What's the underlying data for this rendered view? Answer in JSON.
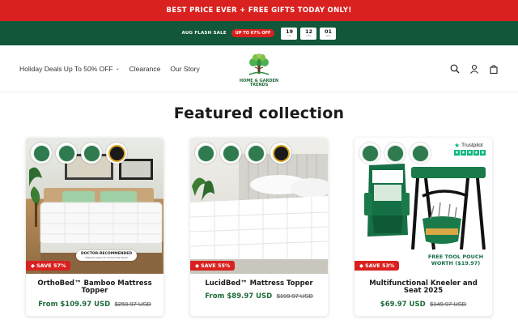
{
  "announcement": "BEST PRICE EVER + FREE GIFTS TODAY ONLY!",
  "flash_sale": {
    "label": "AUG FLASH SALE",
    "pill": "UP TO 67% OFF",
    "timer": [
      {
        "value": "19",
        "unit": "hrs"
      },
      {
        "value": "12",
        "unit": "mins"
      },
      {
        "value": "01",
        "unit": "secs"
      }
    ]
  },
  "nav": {
    "items": [
      {
        "label": "Holiday Deals Up To 50% OFF",
        "has_dropdown": true
      },
      {
        "label": "Clearance"
      },
      {
        "label": "Our Story"
      }
    ]
  },
  "logo": {
    "line1": "HOME & GARDEN",
    "line2": "TRENDS"
  },
  "header_icons": [
    "search-icon",
    "account-icon",
    "cart-icon"
  ],
  "section": {
    "title": "Featured collection"
  },
  "products": [
    {
      "title": "OrthoBed™ Bamboo Mattress Topper",
      "price": "From $109.97 USD",
      "compare_price": "$259.97 USD",
      "badge": "SAVE 57%",
      "overlay_title": "DOCTOR-RECOMMENDED",
      "overlay_sub": "Mattress Topper for Chronic Pain Relief"
    },
    {
      "title": "LucidBed™ Mattress Topper",
      "price": "From $89.97 USD",
      "compare_price": "$199.97 USD",
      "badge": "SAVE 55%"
    },
    {
      "title": "Multifunctional Kneeler and Seat 2025",
      "price": "$69.97 USD",
      "compare_price": "$149.97 USD",
      "badge": "SAVE 53%",
      "trustpilot": "Trustpilot",
      "overlay_text": "FREE TOOL POUCH WORTH ($19.97)"
    }
  ],
  "colors": {
    "announcement_bg": "#d9211f",
    "flash_bg": "#12573a",
    "price": "#1f6b3a",
    "badge": "#d9211f"
  }
}
